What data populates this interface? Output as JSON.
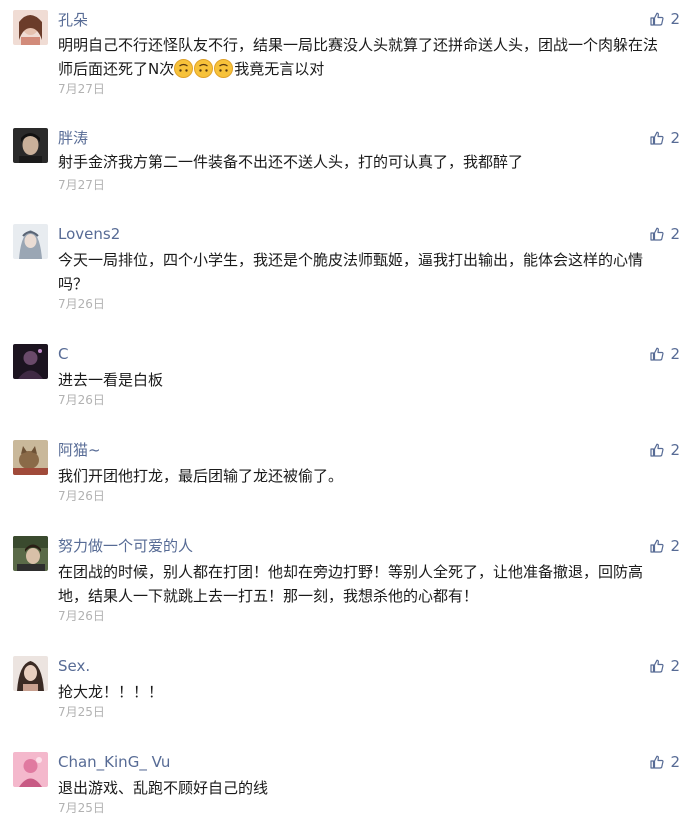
{
  "comments": [
    {
      "name": "孔朵",
      "text_before": "明明自己不行还怪队友不行，结果一局比赛没人头就算了还拼命送人头，团战一个肉躲在法师后面还死了N次",
      "emojis": [
        "upside-down-face",
        "upside-down-face",
        "upside-down-face"
      ],
      "text_after": "我竟无言以对",
      "date": "7月27日",
      "likes": "2",
      "avatar_color": "#d9b3a8"
    },
    {
      "name": "胖涛",
      "text": "射手金济我方第二一件装备不出还不送人头，打的可认真了，我都醉了",
      "date": "7月27日",
      "likes": "2",
      "avatar_color": "#3a3a3a"
    },
    {
      "name": "Lovens2",
      "text": "今天一局排位，四个小学生，我还是个脆皮法师甄姬，逼我打出输出，能体会这样的心情吗？",
      "date": "7月26日",
      "likes": "2",
      "avatar_color": "#aab4c0"
    },
    {
      "name": "C 󠀠",
      "text": "进去一看是白板",
      "date": "7月26日",
      "likes": "2",
      "avatar_color": "#2b1f2a"
    },
    {
      "name": "阿猫~",
      "text": "我们开团他打龙，最后团输了龙还被偷了。",
      "date": "7月26日",
      "likes": "2",
      "avatar_color": "#8a6a48"
    },
    {
      "name": "努力做一个可爱的人",
      "text": "在团战的时候，别人都在打团！他却在旁边打野！等别人全死了，让他准备撤退，回防高地，结果人一下就跳上去一打五！那一刻，我想杀他的心都有！",
      "date": "7月26日",
      "likes": "2",
      "avatar_color": "#4b5a3a"
    },
    {
      "name": "Sex.",
      "text": "抢大龙！！！！",
      "date": "7月25日",
      "likes": "2",
      "avatar_color": "#b89a90"
    },
    {
      "name": "Chan_KinG_ Vu",
      "text": "退出游戏、乱跑不顾好自己的线",
      "date": "7月25日",
      "likes": "2",
      "avatar_color": "#e07aa0"
    }
  ],
  "icons": {
    "like": "thumbs-up-icon",
    "emoji": "upside-down-face-emoji-icon"
  },
  "colors": {
    "name": "#576b95",
    "text": "#1a1a1a",
    "date": "#b2b2b2",
    "like": "#576b95"
  }
}
